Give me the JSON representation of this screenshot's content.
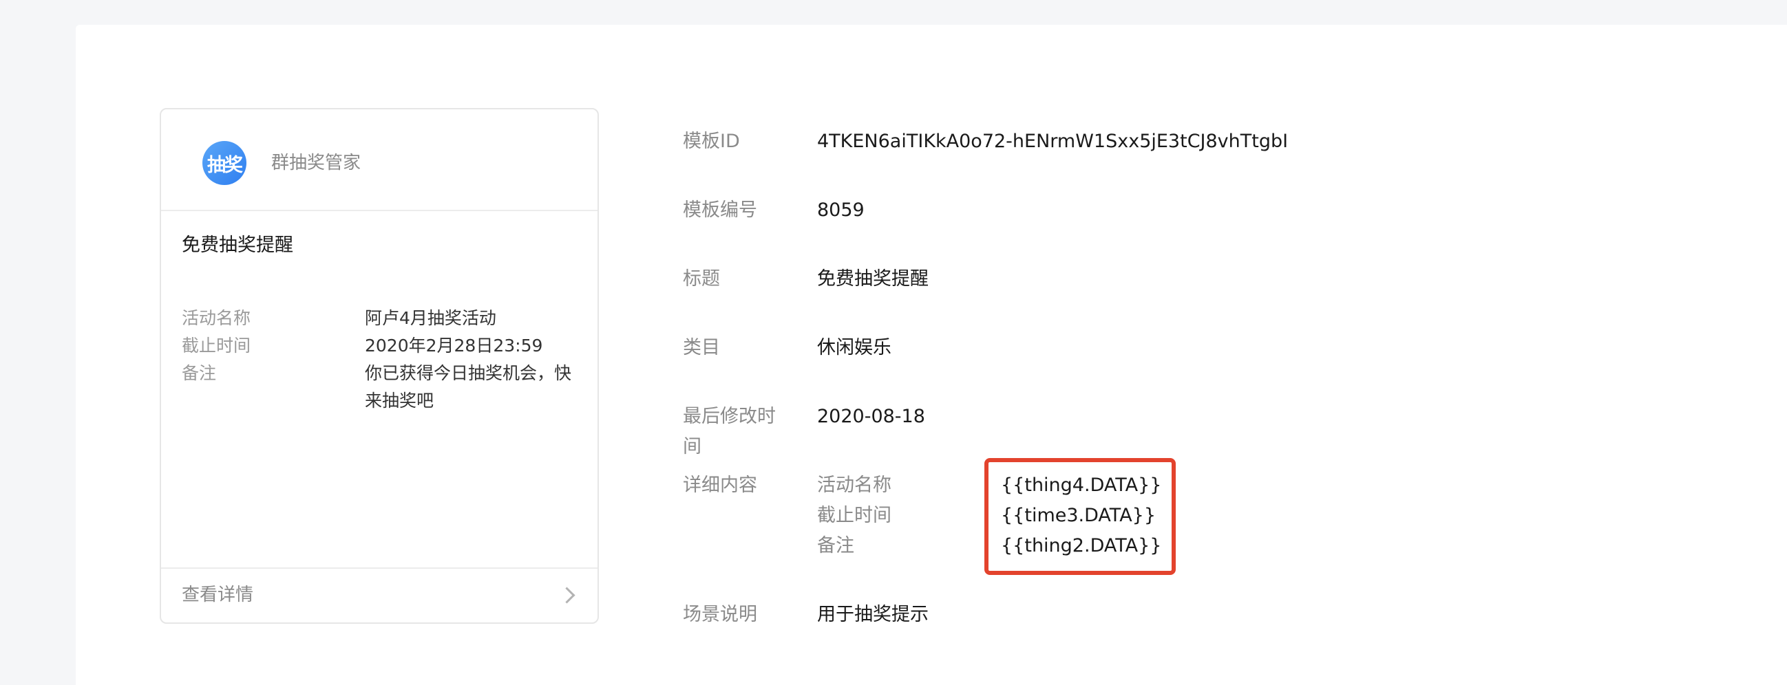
{
  "preview_card": {
    "avatar_text": "抽奖",
    "account_name": "群抽奖管家",
    "title": "免费抽奖提醒",
    "fields": [
      {
        "key": "活动名称",
        "value": "阿卢4月抽奖活动"
      },
      {
        "key": "截止时间",
        "value": "2020年2月28日23:59"
      },
      {
        "key": "备注",
        "value": "你已获得今日抽奖机会，快来抽奖吧"
      }
    ],
    "footer_label": "查看详情"
  },
  "template_info": {
    "template_id_label": "模板ID",
    "template_id": "4TKEN6aiTIKkA0o72-hENrmW1Sxx5jE3tCJ8vhTtgbI",
    "template_number_label": "模板编号",
    "template_number": "8059",
    "title_label": "标题",
    "title": "免费抽奖提醒",
    "category_label": "类目",
    "category": "休闲娱乐",
    "last_modified_label": "最后修改时间",
    "last_modified": "2020-08-18",
    "details_label": "详细内容",
    "details": [
      {
        "key": "活动名称",
        "var": "{{thing4.DATA}}"
      },
      {
        "key": "截止时间",
        "var": "{{time3.DATA}}"
      },
      {
        "key": "备注",
        "var": "{{thing2.DATA}}"
      }
    ],
    "scene_label": "场景说明",
    "scene": "用于抽奖提示"
  },
  "colors": {
    "highlight_border": "#e3432d",
    "avatar_blue": "#3a8cf3"
  }
}
